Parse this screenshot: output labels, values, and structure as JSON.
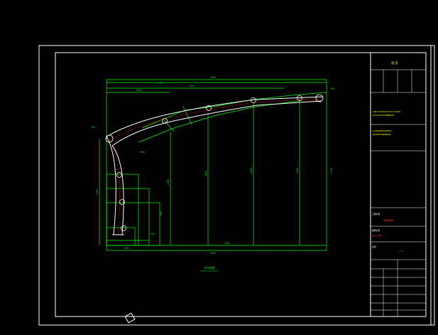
{
  "drawing": {
    "section_title": "A-A剖面",
    "dimensions": {
      "top_overall": "3200",
      "top_second": "2450",
      "top_third": "1900",
      "top_fourth": "1750",
      "bottom_overall": "3000",
      "bottom_main": "2400",
      "bottom_left": "400",
      "height_left": "2100",
      "height_right": "1710",
      "vertical_1": "1450",
      "vertical_2": "1610",
      "vertical_3": "1440",
      "vertical_4": "1300",
      "arc_radius": "R80",
      "left_col_1": "850",
      "left_col_2": "430",
      "callout_left": "700",
      "callout_right": "700"
    }
  },
  "title_block": {
    "header": "图 签",
    "note_1": "1.本图尺寸单位除标高以米计外,余均以毫米计。",
    "note_2": "2.施工时应与其他专业图纸配合施工。",
    "note_3": "3.未尽事宜按国家有关规范执行。",
    "note_4": "4.图中钢构件均需做防锈处理。",
    "project_label": "工程名称",
    "project_value": "钢结构雨棚",
    "drawing_label": "图纸名称",
    "drawing_value": "雨棚节点详图",
    "scale_label": "比例",
    "scale_value": "1:20"
  },
  "colors": {
    "background": "#000000",
    "frame": "#ffffff",
    "dimension": "#00ff00",
    "structure": "#ffffff",
    "centerline": "#ff0000",
    "title_text": "#ff3333",
    "note_text": "#ffff00"
  }
}
